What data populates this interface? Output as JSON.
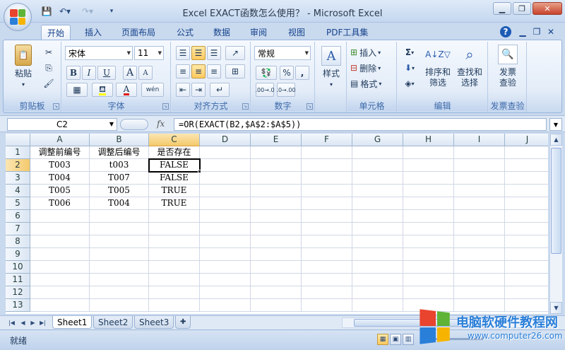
{
  "window": {
    "title": "Excel EXACT函数怎么使用？ - Microsoft Excel"
  },
  "ribbon_tabs": [
    {
      "label": "开始",
      "active": true
    },
    {
      "label": "插入"
    },
    {
      "label": "页面布局"
    },
    {
      "label": "公式"
    },
    {
      "label": "数据"
    },
    {
      "label": "审阅"
    },
    {
      "label": "视图"
    },
    {
      "label": "PDF工具集"
    }
  ],
  "ribbon": {
    "clipboard": {
      "label": "剪贴板",
      "paste": "粘贴"
    },
    "font": {
      "label": "字体",
      "name": "宋体",
      "size": "11",
      "bold": "B",
      "italic": "I",
      "underline": "U",
      "grow": "A",
      "shrink": "A",
      "font_color": "A",
      "phonetic": "wén"
    },
    "alignment": {
      "label": "对齐方式"
    },
    "number": {
      "label": "数字",
      "format": "常规",
      "percent": "%",
      "comma": ",",
      "inc_decimal": ".00→.0",
      "dec_decimal": ".0→.00"
    },
    "styles": {
      "label": "样式"
    },
    "cells": {
      "label": "单元格",
      "insert": "插入",
      "delete": "删除",
      "format": "格式"
    },
    "editing": {
      "label": "编辑",
      "sort_filter": "排序和\n筛选",
      "find_select": "查找和\n选择"
    },
    "invoice": {
      "label": "发票查验",
      "button": "发票\n查验"
    }
  },
  "formula_bar": {
    "name_box": "C2",
    "fx": "fx",
    "formula": "=OR(EXACT(B2,$A$2:$A$5))"
  },
  "sheet": {
    "columns": [
      "A",
      "B",
      "C",
      "D",
      "E",
      "F",
      "G",
      "H",
      "I",
      "J"
    ],
    "rows": [
      "1",
      "2",
      "3",
      "4",
      "5",
      "6",
      "7",
      "8",
      "9",
      "10",
      "11",
      "12",
      "13"
    ],
    "active_cell": "C2",
    "cells": [
      [
        "调整前编号",
        "调整后编号",
        "是否存在"
      ],
      [
        "T003",
        "t003",
        "FALSE"
      ],
      [
        "T004",
        "T007",
        "FALSE"
      ],
      [
        "T005",
        "T005",
        "TRUE"
      ],
      [
        "T006",
        "T004",
        "TRUE"
      ]
    ]
  },
  "sheet_tabs": [
    {
      "label": "Sheet1",
      "active": true
    },
    {
      "label": "Sheet2"
    },
    {
      "label": "Sheet3"
    }
  ],
  "status": {
    "text": "就绪"
  },
  "watermark": {
    "title": "电脑软硬件教程网",
    "url": "www.computer26.com"
  },
  "colors": {
    "office_red": "#e8442e",
    "office_green": "#5fb336",
    "office_blue": "#2a7fd9",
    "office_yellow": "#f6b400",
    "selection_header": "#f4c96c"
  }
}
